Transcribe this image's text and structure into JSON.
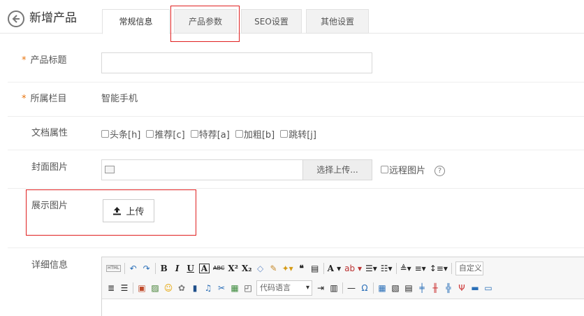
{
  "header": {
    "title": "新增产品"
  },
  "tabs": [
    {
      "label": "常规信息"
    },
    {
      "label": "产品参数"
    },
    {
      "label": "SEO设置"
    },
    {
      "label": "其他设置"
    }
  ],
  "form": {
    "title_label": "产品标题",
    "title_value": "",
    "column_label": "所属栏目",
    "column_value": "智能手机",
    "attr_label": "文档属性",
    "attrs": [
      "头条[h]",
      "推荐[c]",
      "特荐[a]",
      "加粗[b]",
      "跳转[j]"
    ],
    "cover_label": "封面图片",
    "cover_button": "选择上传...",
    "remote_label": "远程图片",
    "help_icon": "?",
    "gallery_label": "展示图片",
    "upload_button": "上传",
    "detail_label": "详细信息",
    "required_mark": "*"
  },
  "editor": {
    "html_label": "HTML",
    "code_lang": "代码语言",
    "font_family": "自定义"
  },
  "colors": {
    "highlight": "#e02020",
    "required": "#e8730c"
  }
}
